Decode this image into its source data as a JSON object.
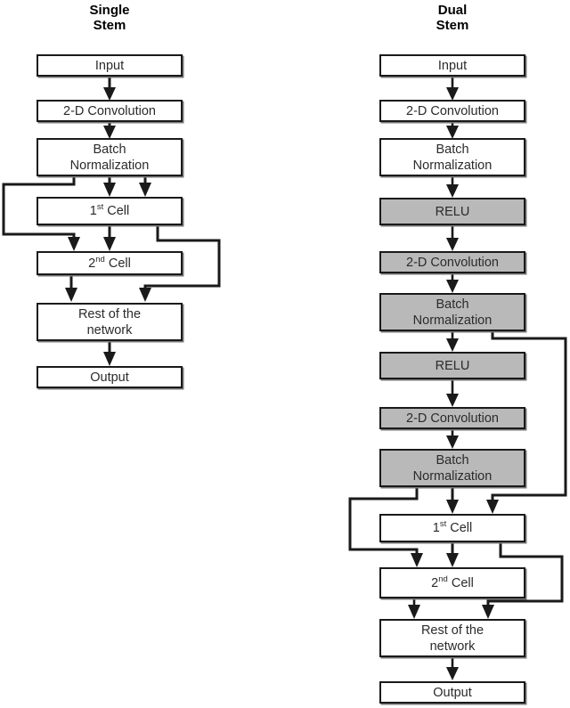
{
  "figure": {
    "type": "flowchart",
    "background": "#ffffff",
    "box_fill_plain": "#ffffff",
    "box_fill_shaded": "#b9b9b9",
    "line_color": "#1a1a1a"
  },
  "columns": [
    {
      "id": "single-stem",
      "title_line1": "Single",
      "title_line2": "Stem",
      "nodes": [
        {
          "id": "l-input",
          "label": "Input",
          "shaded": false
        },
        {
          "id": "l-conv",
          "label": "2-D Convolution",
          "shaded": false
        },
        {
          "id": "l-bn",
          "label": "Batch Normalization",
          "line1": "Batch",
          "line2": "Normalization",
          "shaded": false
        },
        {
          "id": "l-cell1",
          "label": "1st Cell",
          "pre": "1",
          "sup": "st",
          "post": " Cell",
          "shaded": false
        },
        {
          "id": "l-cell2",
          "label": "2nd Cell",
          "pre": "2",
          "sup": "nd",
          "post": " Cell",
          "shaded": false
        },
        {
          "id": "l-rest",
          "label": "Rest of the network",
          "line1": "Rest of the",
          "line2": "network",
          "shaded": false
        },
        {
          "id": "l-output",
          "label": "Output",
          "shaded": false
        }
      ],
      "edges": [
        {
          "from": "l-input",
          "to": "l-conv",
          "kind": "straight"
        },
        {
          "from": "l-conv",
          "to": "l-bn",
          "kind": "straight"
        },
        {
          "from": "l-bn",
          "to": "l-cell1",
          "kind": "straight"
        },
        {
          "from": "l-bn",
          "to": "l-cell1",
          "kind": "straight-right"
        },
        {
          "from": "l-bn",
          "to": "l-cell2",
          "kind": "skip-left"
        },
        {
          "from": "l-cell1",
          "to": "l-cell2",
          "kind": "straight"
        },
        {
          "from": "l-cell1",
          "to": "l-rest",
          "kind": "skip-right"
        },
        {
          "from": "l-cell2",
          "to": "l-rest",
          "kind": "straight"
        },
        {
          "from": "l-rest",
          "to": "l-output",
          "kind": "straight"
        }
      ]
    },
    {
      "id": "dual-stem",
      "title_line1": "Dual",
      "title_line2": "Stem",
      "nodes": [
        {
          "id": "r-input",
          "label": "Input",
          "shaded": false
        },
        {
          "id": "r-conv1",
          "label": "2-D Convolution",
          "shaded": false
        },
        {
          "id": "r-bn1",
          "label": "Batch Normalization",
          "line1": "Batch",
          "line2": "Normalization",
          "shaded": false
        },
        {
          "id": "r-relu1",
          "label": "RELU",
          "shaded": true
        },
        {
          "id": "r-conv2",
          "label": "2-D Convolution",
          "shaded": true
        },
        {
          "id": "r-bn2",
          "label": "Batch Normalization",
          "line1": "Batch",
          "line2": "Normalization",
          "shaded": true
        },
        {
          "id": "r-relu2",
          "label": "RELU",
          "shaded": true
        },
        {
          "id": "r-conv3",
          "label": "2-D Convolution",
          "shaded": true
        },
        {
          "id": "r-bn3",
          "label": "Batch Normalization",
          "line1": "Batch",
          "line2": "Normalization",
          "shaded": true
        },
        {
          "id": "r-cell1",
          "label": "1st Cell",
          "pre": "1",
          "sup": "st",
          "post": " Cell",
          "shaded": false
        },
        {
          "id": "r-cell2",
          "label": "2nd Cell",
          "pre": "2",
          "sup": "nd",
          "post": " Cell",
          "shaded": false
        },
        {
          "id": "r-rest",
          "label": "Rest of the network",
          "line1": "Rest of the",
          "line2": "network",
          "shaded": false
        },
        {
          "id": "r-output",
          "label": "Output",
          "shaded": false
        }
      ],
      "edges": [
        {
          "from": "r-input",
          "to": "r-conv1",
          "kind": "straight"
        },
        {
          "from": "r-conv1",
          "to": "r-bn1",
          "kind": "straight"
        },
        {
          "from": "r-bn1",
          "to": "r-relu1",
          "kind": "straight"
        },
        {
          "from": "r-relu1",
          "to": "r-conv2",
          "kind": "straight"
        },
        {
          "from": "r-conv2",
          "to": "r-bn2",
          "kind": "straight"
        },
        {
          "from": "r-bn2",
          "to": "r-relu2",
          "kind": "straight"
        },
        {
          "from": "r-bn2",
          "to": "r-cell1",
          "kind": "skip-right-long"
        },
        {
          "from": "r-relu2",
          "to": "r-conv3",
          "kind": "straight"
        },
        {
          "from": "r-conv3",
          "to": "r-bn3",
          "kind": "straight"
        },
        {
          "from": "r-bn3",
          "to": "r-cell1",
          "kind": "straight"
        },
        {
          "from": "r-bn3",
          "to": "r-cell2",
          "kind": "skip-left"
        },
        {
          "from": "r-cell1",
          "to": "r-cell2",
          "kind": "straight"
        },
        {
          "from": "r-cell1",
          "to": "r-rest",
          "kind": "skip-right"
        },
        {
          "from": "r-cell2",
          "to": "r-rest",
          "kind": "straight"
        },
        {
          "from": "r-rest",
          "to": "r-output",
          "kind": "straight"
        }
      ]
    }
  ]
}
